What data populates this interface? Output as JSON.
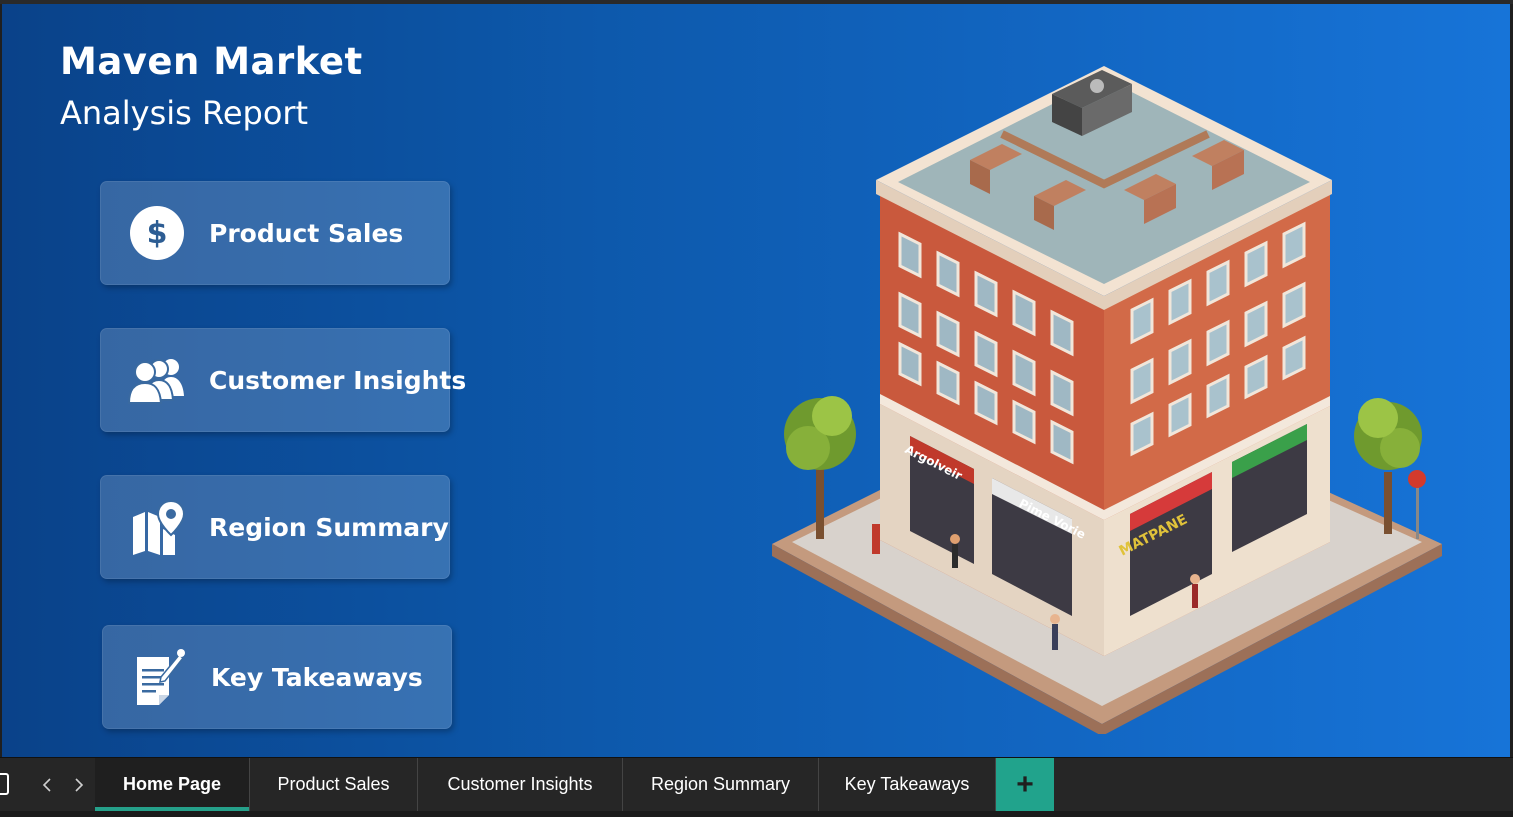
{
  "header": {
    "title": "Maven Market",
    "subtitle": "Analysis Report"
  },
  "nav_buttons": [
    {
      "label": "Product Sales",
      "icon": "dollar-circle-icon"
    },
    {
      "label": "Customer Insights",
      "icon": "users-group-icon"
    },
    {
      "label": "Region Summary",
      "icon": "map-pin-icon"
    },
    {
      "label": "Key Takeaways",
      "icon": "document-icon"
    }
  ],
  "illustration": {
    "signs": [
      "Argolveir",
      "Pime Vorie",
      "MATPANE"
    ]
  },
  "tabs": [
    {
      "label": "Home Page",
      "active": true
    },
    {
      "label": "Product Sales",
      "active": false
    },
    {
      "label": "Customer Insights",
      "active": false
    },
    {
      "label": "Region Summary",
      "active": false
    },
    {
      "label": "Key Takeaways",
      "active": false
    }
  ],
  "add_tab_label": "+",
  "colors": {
    "background_start": "#0a4289",
    "background_end": "#1774d8",
    "tab_accent": "#25a08a",
    "button_fill": "rgba(255,255,255,0.18)"
  }
}
